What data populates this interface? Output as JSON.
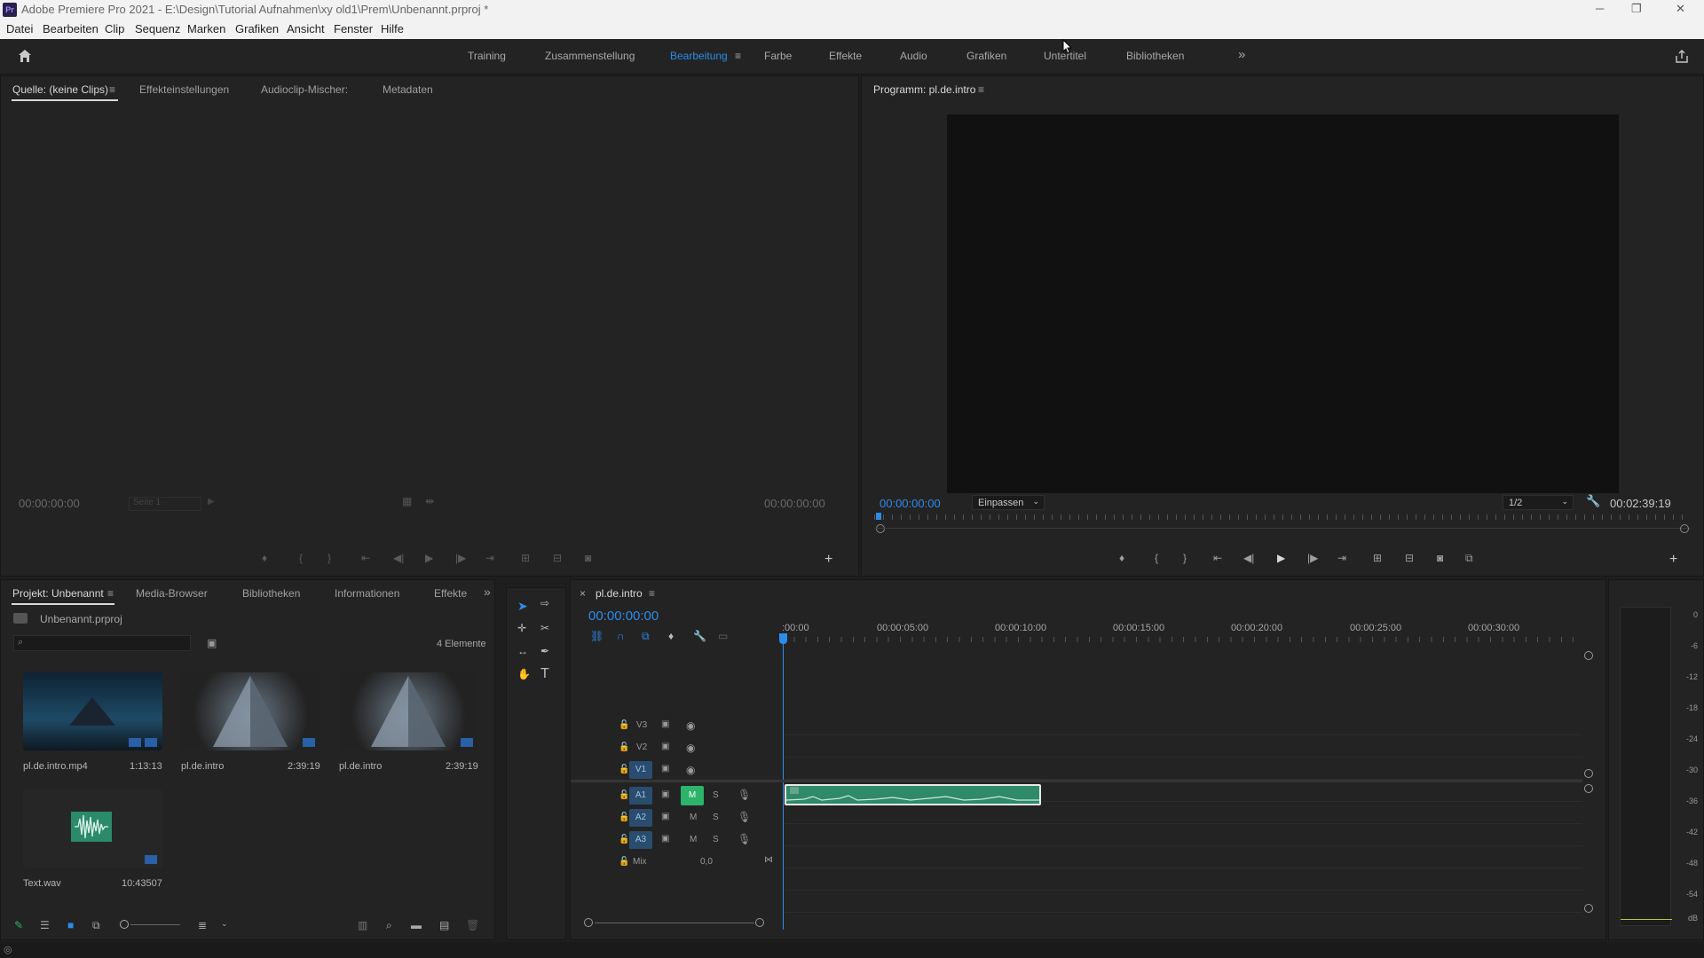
{
  "window": {
    "app_icon": "Pr",
    "title": "Adobe Premiere Pro 2021 - E:\\Design\\Tutorial Aufnahmen\\xy old1\\Prem\\Unbenannt.prproj *",
    "minimize": "─",
    "maximize": "❐",
    "close": "✕"
  },
  "menu": [
    "Datei",
    "Bearbeiten",
    "Clip",
    "Sequenz",
    "Marken",
    "Grafiken",
    "Ansicht",
    "Fenster",
    "Hilfe"
  ],
  "workspaces": {
    "items": [
      "Training",
      "Zusammenstellung",
      "Bearbeitung",
      "Farbe",
      "Effekte",
      "Audio",
      "Grafiken",
      "Untertitel",
      "Bibliotheken"
    ],
    "active": "Bearbeitung",
    "more": "»"
  },
  "source_panel": {
    "tabs": [
      "Quelle: (keine Clips)",
      "Effekteinstellungen",
      "Audioclip-Mischer:",
      "Metadaten"
    ],
    "timecode_left": "00:00:00:00",
    "timecode_right": "00:00:00:00",
    "page_select": "Seite 1"
  },
  "program_panel": {
    "title": "Programm: pl.de.intro",
    "timecode": "00:00:00:00",
    "fit": "Einpassen",
    "resolution": "1/2",
    "duration": "00:02:39:19"
  },
  "project_panel": {
    "tabs": [
      "Projekt: Unbenannt",
      "Media-Browser",
      "Bibliotheken",
      "Informationen",
      "Effekte"
    ],
    "project_file": "Unbenannt.prproj",
    "search_placeholder": "",
    "count": "4 Elemente",
    "items": [
      {
        "name": "pl.de.intro.mp4",
        "duration": "1:13:13"
      },
      {
        "name": "pl.de.intro",
        "duration": "2:39:19"
      },
      {
        "name": "pl.de.intro",
        "duration": "2:39:19"
      },
      {
        "name": "Text.wav",
        "duration": "10:43507"
      }
    ]
  },
  "timeline": {
    "sequence_name": "pl.de.intro",
    "timecode": "00:00:00:00",
    "ruler": [
      ":00:00",
      "00:00:05:00",
      "00:00:10:00",
      "00:00:15:00",
      "00:00:20:00",
      "00:00:25:00",
      "00:00:30:00"
    ],
    "video_tracks": [
      "V3",
      "V2",
      "V1"
    ],
    "audio_tracks": [
      "A1",
      "A2",
      "A3"
    ],
    "mute_label": "M",
    "solo_label": "S",
    "mix_label": "Mix",
    "mix_value": "0,0"
  },
  "audio_meter": {
    "labels": [
      "0",
      "-6",
      "-12",
      "-18",
      "-24",
      "-30",
      "-36",
      "-42",
      "-48",
      "-54",
      "dB"
    ]
  },
  "colors": {
    "accent_blue": "#2d8ceb",
    "clip_green": "#2e8a68",
    "mute_green": "#2db36a"
  }
}
